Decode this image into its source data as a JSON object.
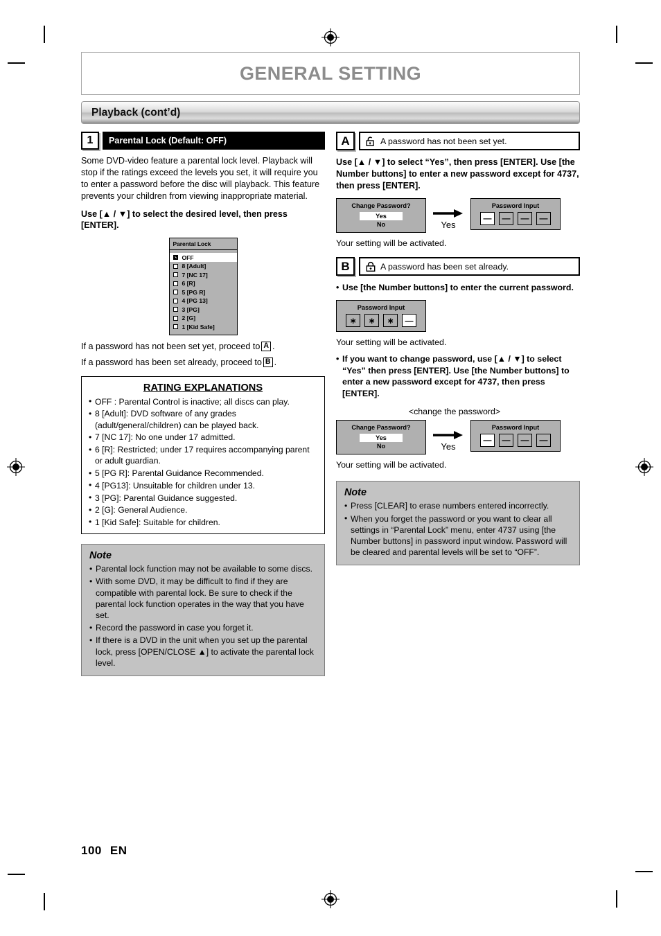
{
  "header": {
    "chapter_title": "GENERAL SETTING",
    "section_title": "Playback (cont’d)"
  },
  "left": {
    "step_number": "1",
    "step_title": "Parental Lock (Default: OFF)",
    "intro": "Some DVD-video feature a parental lock level. Playback will stop if the ratings exceed the levels you set, it will require you to enter a password before the disc will playback. This feature prevents your children from viewing inappropriate material.",
    "instruction": "Use [▲ / ▼] to select the desired level, then press [ENTER].",
    "osd": {
      "title": "Parental Lock",
      "items": [
        {
          "label": "OFF",
          "checked": true,
          "selected": true
        },
        {
          "label": "8 [Adult]",
          "checked": false,
          "selected": false
        },
        {
          "label": "7 [NC 17]",
          "checked": false,
          "selected": false
        },
        {
          "label": "6 [R]",
          "checked": false,
          "selected": false
        },
        {
          "label": "5 [PG R]",
          "checked": false,
          "selected": false
        },
        {
          "label": "4 [PG 13]",
          "checked": false,
          "selected": false
        },
        {
          "label": "3 [PG]",
          "checked": false,
          "selected": false
        },
        {
          "label": "2 [G]",
          "checked": false,
          "selected": false
        },
        {
          "label": "1 [Kid Safe]",
          "checked": false,
          "selected": false
        }
      ]
    },
    "proceed_a_pre": "If a password has not been set yet, proceed to",
    "proceed_a_key": "A",
    "proceed_a_post": ".",
    "proceed_b_pre": "If a password has been set already, proceed to",
    "proceed_b_key": "B",
    "proceed_b_post": ".",
    "ratings": {
      "title": "RATING EXPLANATIONS",
      "items": [
        "OFF : Parental Control is inactive; all discs can play.",
        "8 [Adult]: DVD software of any grades (adult/general/children) can be played back.",
        "7 [NC 17]: No one under 17 admitted.",
        "6 [R]: Restricted; under 17 requires accompanying parent or adult guardian.",
        "5 [PG R]: Parental Guidance Recommended.",
        "4 [PG13]: Unsuitable for children under 13.",
        "3 [PG]: Parental Guidance suggested.",
        "2 [G]: General Audience.",
        "1 [Kid Safe]: Suitable for children."
      ]
    },
    "note": {
      "title": "Note",
      "items": [
        "Parental lock function may not be available to some discs.",
        "With some DVD, it may be difficult to find if they are compatible with parental lock. Be sure to check if the parental lock function operates in the way that you have set.",
        "Record the password in case you forget it.",
        "If there is a DVD in the unit when you set up the parental lock, press [OPEN/CLOSE ▲] to activate the parental lock level."
      ]
    }
  },
  "right": {
    "a": {
      "letter": "A",
      "icon": "unlocked-padlock-icon",
      "headline": "A password has not been set yet.",
      "instruction": "Use [▲ / ▼] to select “Yes”, then press [ENTER]. Use [the Number buttons] to enter a new password except for 4737, then press [ENTER].",
      "dialog": {
        "title": "Change Password?",
        "option_yes": "Yes",
        "option_no": "No"
      },
      "arrow_label": "Yes",
      "password_window": {
        "title": "Password Input",
        "slots": [
          "—",
          "—",
          "—",
          "—"
        ],
        "active_index": 0
      },
      "result": "Your setting will be activated."
    },
    "b": {
      "letter": "B",
      "icon": "locked-padlock-icon",
      "headline": "A password has been set already.",
      "instruction_1": "Use [the Number buttons] to enter the current password.",
      "password_window_1": {
        "title": "Password Input",
        "slots": [
          "∗",
          "∗",
          "∗",
          "—"
        ],
        "active_index": 3
      },
      "result_1": "Your setting will be activated.",
      "instruction_2": "If you want to change password, use [▲ / ▼] to select “Yes” then press [ENTER]. Use [the Number buttons] to enter a new password except for 4737, then press [ENTER].",
      "change_caption": "<change the password>",
      "dialog": {
        "title": "Change Password?",
        "option_yes": "Yes",
        "option_no": "No"
      },
      "arrow_label": "Yes",
      "password_window_2": {
        "title": "Password Input",
        "slots": [
          "—",
          "—",
          "—",
          "—"
        ],
        "active_index": 0
      },
      "result_2": "Your setting will be activated."
    },
    "note": {
      "title": "Note",
      "items": [
        "Press [CLEAR] to erase numbers entered incorrectly.",
        "When you forget the password or you want to clear all settings in “Parental Lock” menu, enter 4737 using [the Number buttons] in password input window. Password will be cleared and parental levels will be set to “OFF”."
      ]
    }
  },
  "footer": {
    "page_number": "100",
    "language": "EN"
  },
  "colors": {
    "chapter_title": "#8c8c8c",
    "note_bg": "#c3c3c3",
    "osd_bg": "#b3b3b3",
    "step_bar_bg": "#000000"
  }
}
